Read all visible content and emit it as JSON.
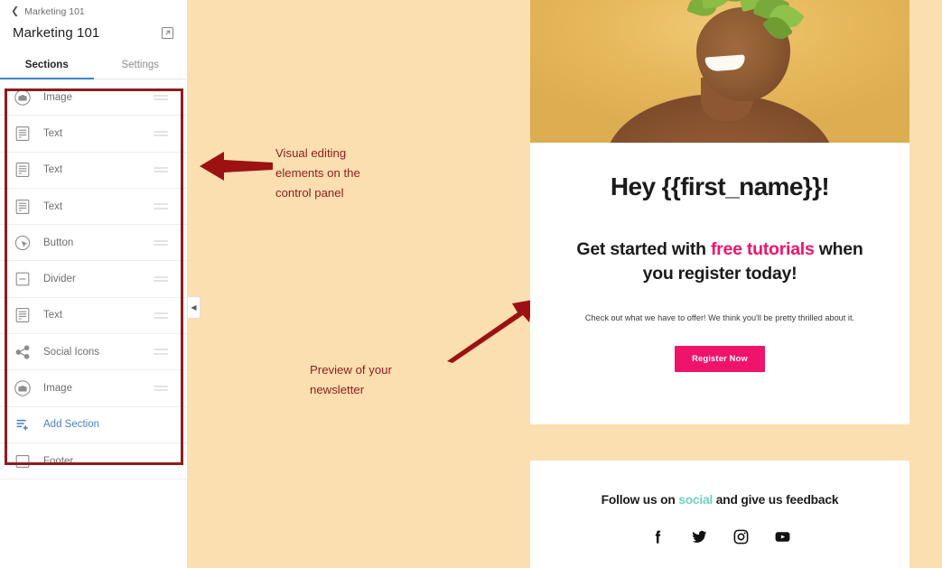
{
  "sidebar": {
    "breadcrumb": {
      "icon": "chevron-left-icon",
      "label": "Marketing 101"
    },
    "doc_title": "Marketing 101",
    "edit_icon": "external-link-icon",
    "tabs": [
      {
        "label": "Sections",
        "active": true
      },
      {
        "label": "Settings",
        "active": false
      }
    ],
    "sections": [
      {
        "label": "Image",
        "icon": "camera-icon",
        "handle": "drag-handle-icon"
      },
      {
        "label": "Text",
        "icon": "text-block-icon",
        "handle": "drag-handle-icon"
      },
      {
        "label": "Text",
        "icon": "text-block-icon",
        "handle": "drag-handle-icon"
      },
      {
        "label": "Text",
        "icon": "text-block-icon",
        "handle": "drag-handle-icon"
      },
      {
        "label": "Button",
        "icon": "button-click-icon",
        "handle": "drag-handle-icon"
      },
      {
        "label": "Divider",
        "icon": "divider-icon",
        "handle": "drag-handle-icon"
      },
      {
        "label": "Text",
        "icon": "text-block-icon",
        "handle": "drag-handle-icon"
      },
      {
        "label": "Social Icons",
        "icon": "share-icon",
        "handle": "drag-handle-icon"
      },
      {
        "label": "Image",
        "icon": "camera-icon",
        "handle": "drag-handle-icon"
      }
    ],
    "add_section": {
      "label": "Add Section",
      "icon": "add-list-icon"
    },
    "footer_item": {
      "label": "Footer",
      "icon": "footer-box-icon"
    },
    "collapse_handle": {
      "icon": "chevron-left-icon"
    }
  },
  "annotations": {
    "accent_color": "#8f1c1c",
    "one": {
      "text": "Visual editing\n elements on the\ncontrol panel",
      "arrow": "arrow-left-icon"
    },
    "two": {
      "text": "Preview of your\nnewsletter",
      "arrow": "arrow-up-right-icon"
    }
  },
  "preview": {
    "hero": {
      "alt": "smiling-woman-with-leaf-crown-photo"
    },
    "headline": "Hey {{first_name}}!",
    "subhead": {
      "part1": "Get started with ",
      "highlight1": "free tutorials",
      "part2": " when you register today!"
    },
    "body_copy": "Check out what we have to offer! We think you'll be pretty thrilled about it.",
    "cta_label": "Register Now",
    "cta_color": "#f0136b",
    "footer": {
      "line_part1": "Follow us on ",
      "line_highlight": "social",
      "line_part2": " and give us feedback",
      "highlight_color": "#6fd2c0",
      "socials": [
        {
          "name": "facebook-icon"
        },
        {
          "name": "twitter-icon"
        },
        {
          "name": "instagram-icon"
        },
        {
          "name": "youtube-icon"
        }
      ]
    }
  }
}
